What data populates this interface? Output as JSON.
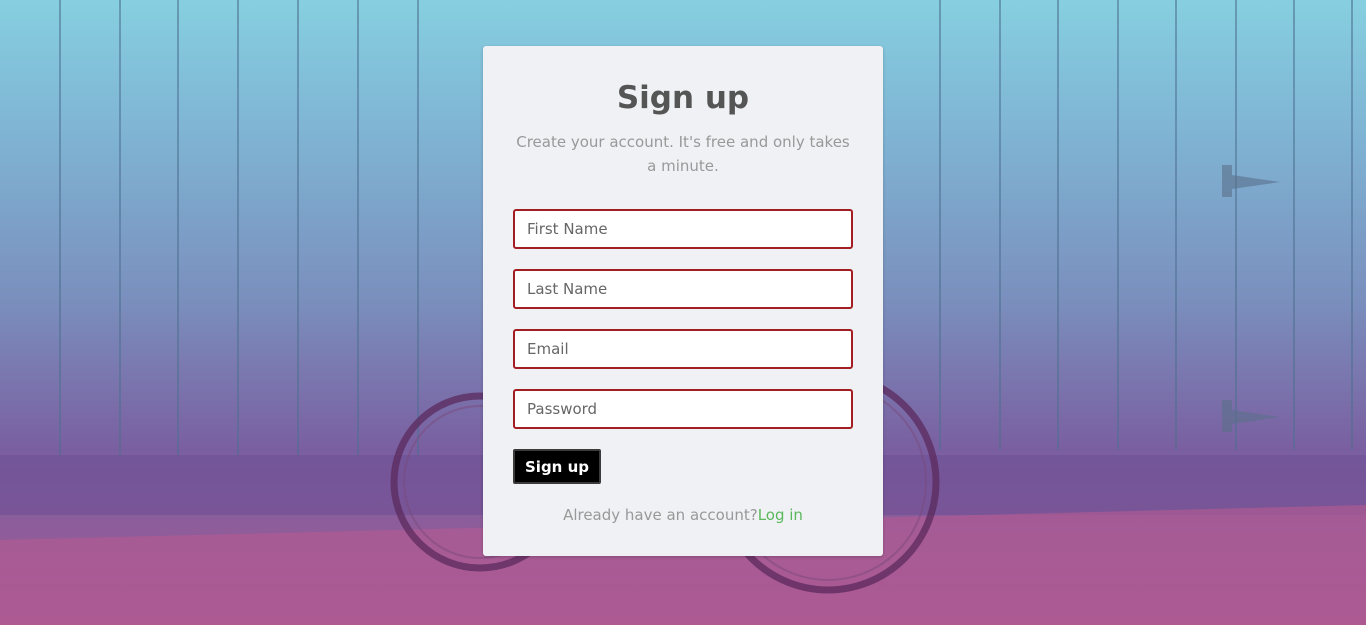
{
  "card": {
    "title": "Sign up",
    "hint": "Create your account. It's free and only takes a minute.",
    "fields": {
      "first_name": {
        "placeholder": "First Name",
        "value": ""
      },
      "last_name": {
        "placeholder": "Last Name",
        "value": ""
      },
      "email": {
        "placeholder": "Email",
        "value": ""
      },
      "password": {
        "placeholder": "Password",
        "value": ""
      }
    },
    "submit_label": "Sign up",
    "footer_text": "Already have an account?",
    "login_label": "Log in"
  },
  "colors": {
    "field_border": "#a21e22",
    "link": "#5cb85c",
    "button": "#000000",
    "card_background": "#f0f1f5"
  }
}
